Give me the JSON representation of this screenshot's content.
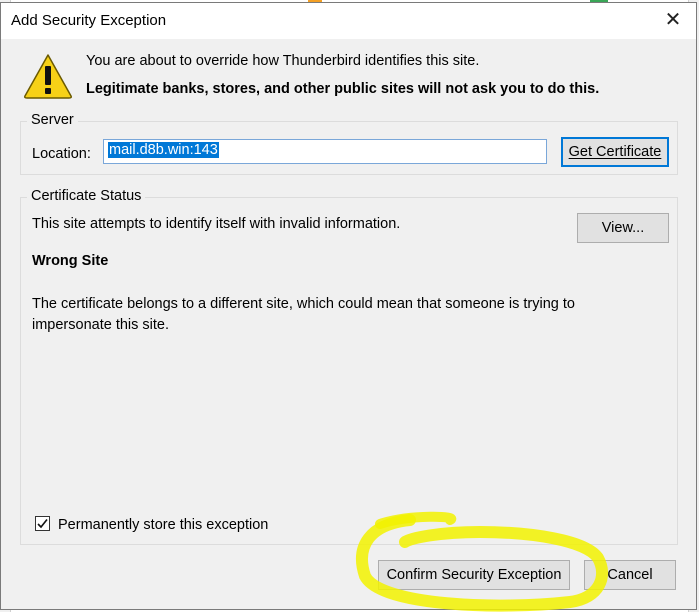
{
  "dialog": {
    "title": "Add Security Exception",
    "close_glyph": "✕",
    "intro_line1": "You are about to override how Thunderbird identifies this site.",
    "intro_line2": "Legitimate banks, stores, and other public sites will not ask you to do this."
  },
  "server": {
    "group_label": "Server",
    "location_label": "Location:",
    "location_value": "mail.d8b.win:143",
    "get_certificate_label": "Get Certificate"
  },
  "certificate_status": {
    "group_label": "Certificate Status",
    "status_text": "This site attempts to identify itself with invalid information.",
    "view_label": "View...",
    "problem_title": "Wrong Site",
    "problem_description": "The certificate belongs to a different site, which could mean that someone is trying to impersonate this site."
  },
  "permanent_store": {
    "label": "Permanently store this exception",
    "checked": true
  },
  "footer": {
    "confirm_label": "Confirm Security Exception",
    "cancel_label": "Cancel"
  },
  "colors": {
    "accent": "#0078d7",
    "highlight": "#f2f200",
    "warning": "#f7d117"
  },
  "icons": {
    "warning": "warning-triangle-icon",
    "close": "close-icon",
    "checkmark": "checkmark-icon"
  }
}
